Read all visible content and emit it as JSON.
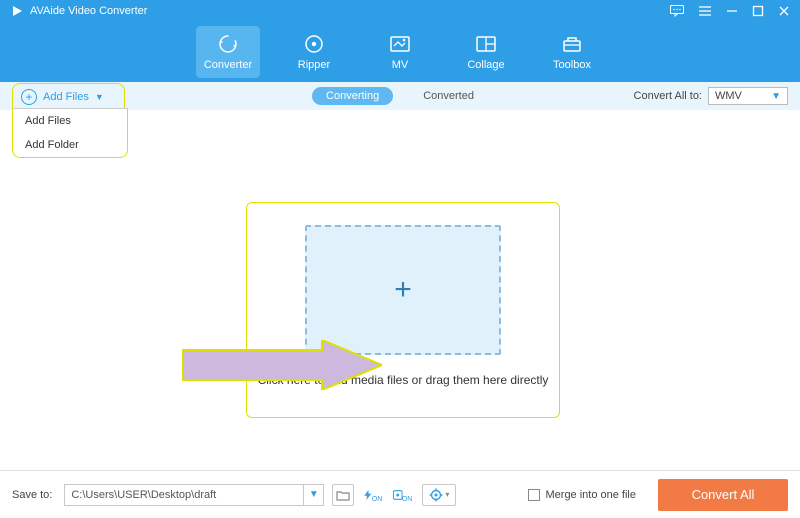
{
  "app": {
    "title": "AVAide Video Converter"
  },
  "toolbar": {
    "items": [
      {
        "label": "Converter"
      },
      {
        "label": "Ripper"
      },
      {
        "label": "MV"
      },
      {
        "label": "Collage"
      },
      {
        "label": "Toolbox"
      }
    ]
  },
  "subbar": {
    "add_files_label": "Add Files",
    "dropdown": {
      "add_files": "Add Files",
      "add_folder": "Add Folder"
    },
    "tab_converting": "Converting",
    "tab_converted": "Converted",
    "convert_all_to_label": "Convert All to:",
    "output_format": "WMV"
  },
  "main": {
    "drop_text": "Click here to add media files or drag them here directly"
  },
  "bottom": {
    "save_to_label": "Save to:",
    "path": "C:\\Users\\USER\\Desktop\\draft",
    "merge_label": "Merge into one file",
    "convert_all_btn": "Convert All"
  }
}
